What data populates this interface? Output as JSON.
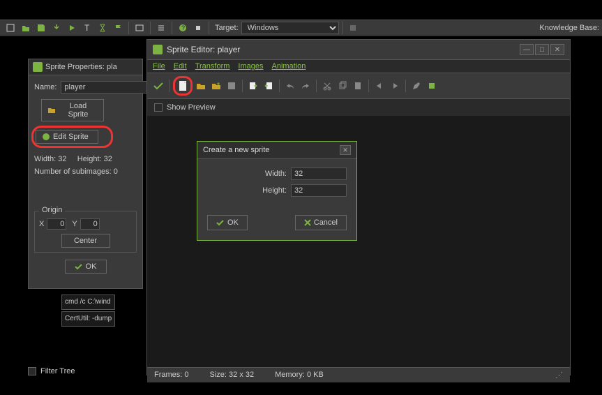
{
  "toolbar": {
    "target_label": "Target:",
    "target_value": "Windows",
    "kb_label": "Knowledge Base:"
  },
  "props": {
    "title": "Sprite Properties: pla",
    "name_label": "Name:",
    "name_value": "player",
    "load_btn": "Load Sprite",
    "edit_btn": "Edit Sprite",
    "width_label": "Width: 32",
    "height_label": "Height: 32",
    "subimages": "Number of subimages: 0",
    "origin_legend": "Origin",
    "x_label": "X",
    "y_label": "Y",
    "x_val": "0",
    "y_val": "0",
    "center_btn": "Center",
    "ok_btn": "OK"
  },
  "editor": {
    "title": "Sprite Editor: player",
    "menu": {
      "file": "File",
      "edit": "Edit",
      "transform": "Transform",
      "images": "Images",
      "animation": "Animation"
    },
    "show_preview": "Show Preview",
    "status": {
      "frames": "Frames: 0",
      "size": "Size: 32 x 32",
      "memory": "Memory: 0 KB"
    }
  },
  "dialog": {
    "title": "Create a new sprite",
    "width_label": "Width:",
    "height_label": "Height:",
    "width_val": "32",
    "height_val": "32",
    "ok": "OK",
    "cancel": "Cancel"
  },
  "filter_tree": "Filter Tree",
  "cmd1": "cmd /c   C:\\wind",
  "cmd2": "CertUtil: -dump"
}
